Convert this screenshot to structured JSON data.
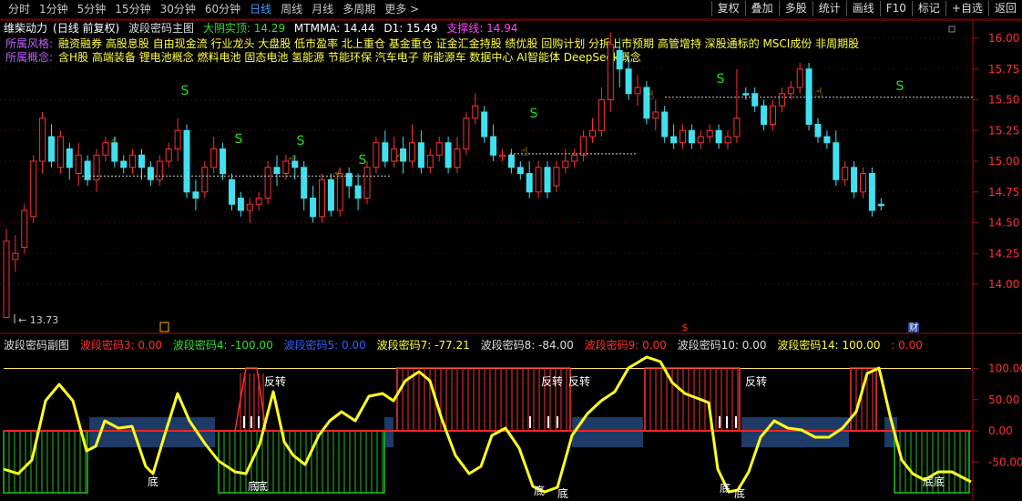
{
  "toolbar": {
    "tabs": [
      "分时",
      "1分钟",
      "5分钟",
      "15分钟",
      "30分钟",
      "60分钟",
      "日线",
      "周线",
      "月线",
      "多周期",
      "更多 >"
    ],
    "active_tab": "日线",
    "right_buttons": [
      "复权",
      "叠加",
      "多股",
      "统计",
      "画线",
      "F10",
      "标记",
      "+自选",
      "返回"
    ]
  },
  "main_header": {
    "stock_name": "维柴动力",
    "period": "(日线 前复权)",
    "indicator": "波段密码主图",
    "big_yin": "大阴实顶: 14.29",
    "mtmma": "MTMMA: 14.44",
    "d1": "D1: 15.49",
    "support": "支撑线: 14.94"
  },
  "concepts": {
    "style_label": "所属风格:",
    "style_value": "融资融券 高股息股 自由现金流 行业龙头 大盘股 低市盈率 北上重仓 基金重仓 证金汇金持股 绩优股 回购计划 分拆上市预期 高管增持 深股通标的 MSCI成份 非周期股",
    "concept_label": "所属概念:",
    "concept_value": "含H股 高端装备 锂电池概念 燃料电池 固态电池 氢能源 节能环保 汽车电子 新能源车 数据中心 AI智能体 DeepSeek概念"
  },
  "price_axis": [
    "16.00",
    "15.75",
    "15.50",
    "15.25",
    "15.00",
    "14.75",
    "14.50",
    "14.25",
    "14.00"
  ],
  "low_marker": "13.73",
  "sub_header": {
    "title": "波段密码副图",
    "c3": "波段密码3: 0.00",
    "c4": "波段密码4: -100.00",
    "c5": "波段密码5: 0.00",
    "c7": "波段密码7: -77.21",
    "c8": "波段密码8: -84.00",
    "c9": "波段密码9: 0.00",
    "c10": "波段密码10: 0.00",
    "c14": "波段密码14: 100.00",
    "c_end": ": 0.00"
  },
  "sub_axis": [
    "100.00",
    "50.00",
    "0.00",
    "-50.00"
  ],
  "labels": {
    "sell": "S",
    "reversal": "反转",
    "bottom": "底",
    "fin": "财",
    "dollar": "$"
  },
  "colors": {
    "up": "#ff3030",
    "down": "#40e0f0",
    "yellow": "#ffff20",
    "green": "#20c020",
    "navy": "#1e3a66"
  }
}
